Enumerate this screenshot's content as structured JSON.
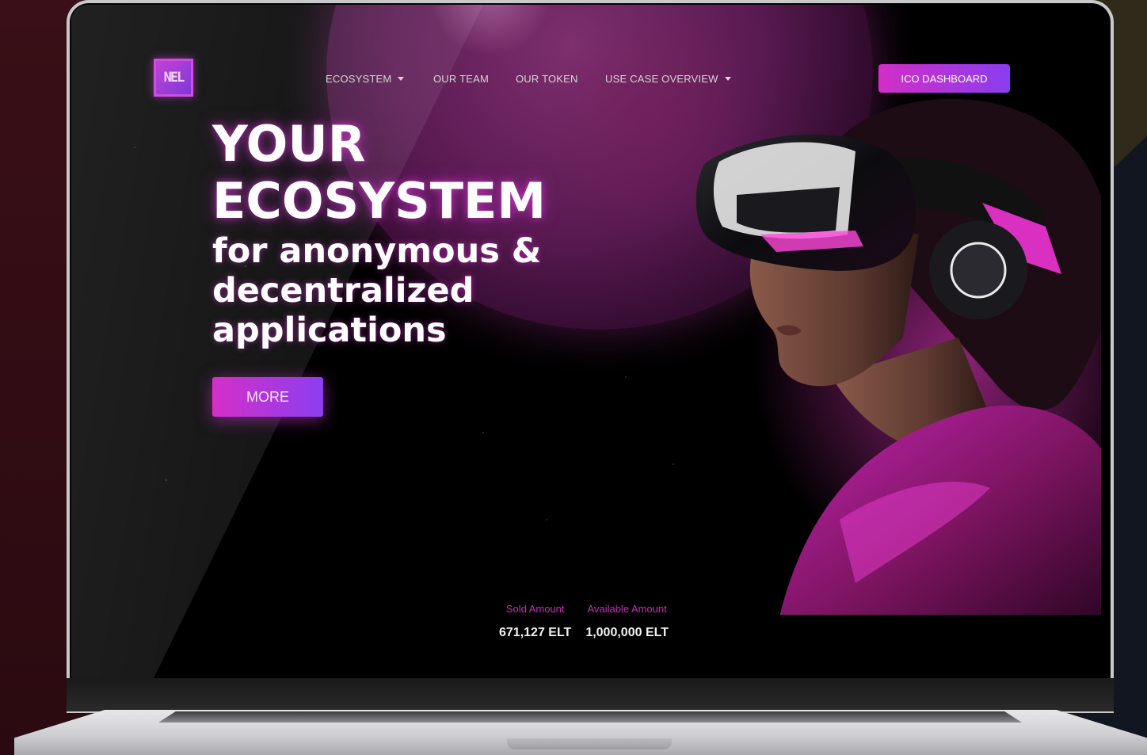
{
  "brand": {
    "logo_text": "NEL",
    "accent_gradient": [
      "#d22ec6",
      "#8a3df0"
    ]
  },
  "nav": {
    "items": [
      {
        "label": "ECOSYSTEM",
        "has_dropdown": true
      },
      {
        "label": "OUR TEAM",
        "has_dropdown": false
      },
      {
        "label": "OUR TOKEN",
        "has_dropdown": false
      },
      {
        "label": "USE CASE OVERVIEW",
        "has_dropdown": true
      }
    ],
    "cta_label": "ICO DASHBOARD"
  },
  "hero": {
    "title_line1": "YOUR",
    "title_line2": "ECOSYSTEM",
    "subtitle_line1": "for anonymous &",
    "subtitle_line2": "decentralized",
    "subtitle_line3": "applications",
    "button_label": "MORE"
  },
  "stats": {
    "sold_label": "Sold Amount",
    "sold_value": "671,127 ELT",
    "available_label": "Available Amount",
    "available_value": "1,000,000 ELT"
  },
  "icons": [
    "chevron-down-icon",
    "logo-icon"
  ],
  "colors": {
    "label_magenta": "#c530b8",
    "screen_bg": "#000000"
  }
}
